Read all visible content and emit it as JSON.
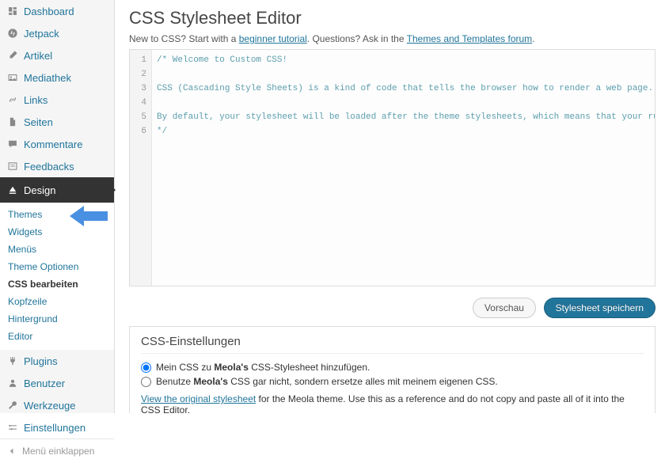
{
  "sidebar": {
    "items": [
      {
        "label": "Dashboard",
        "icon": "dashboard"
      },
      {
        "label": "Jetpack",
        "icon": "jetpack"
      },
      {
        "label": "Artikel",
        "icon": "posts"
      },
      {
        "label": "Mediathek",
        "icon": "media"
      },
      {
        "label": "Links",
        "icon": "links"
      },
      {
        "label": "Seiten",
        "icon": "pages"
      },
      {
        "label": "Kommentare",
        "icon": "comments"
      },
      {
        "label": "Feedbacks",
        "icon": "feedback"
      }
    ],
    "active": {
      "label": "Design",
      "icon": "appearance"
    },
    "submenu": [
      {
        "label": "Themes"
      },
      {
        "label": "Widgets"
      },
      {
        "label": "Menüs"
      },
      {
        "label": "Theme Optionen"
      },
      {
        "label": "CSS bearbeiten",
        "current": true
      },
      {
        "label": "Kopfzeile"
      },
      {
        "label": "Hintergrund"
      },
      {
        "label": "Editor"
      }
    ],
    "items2": [
      {
        "label": "Plugins",
        "icon": "plugins"
      },
      {
        "label": "Benutzer",
        "icon": "users"
      },
      {
        "label": "Werkzeuge",
        "icon": "tools"
      },
      {
        "label": "Einstellungen",
        "icon": "settings"
      }
    ],
    "collapse": "Menü einklappen"
  },
  "page": {
    "title": "CSS Stylesheet Editor",
    "intro_prefix": "New to CSS? Start with a ",
    "intro_link1": "beginner tutorial",
    "intro_mid": ". Questions? Ask in the ",
    "intro_link2": "Themes and Templates forum",
    "intro_suffix": "."
  },
  "editor": {
    "lines": [
      "/* Welcome to Custom CSS!",
      "",
      "CSS (Cascading Style Sheets) is a kind of code that tells the browser how to render a web page. You may delete these comments and get started with your customizations.",
      "",
      "By default, your stylesheet will be loaded after the theme stylesheets, which means that your rules can take precedence and override the theme CSS rules. Just write here what you want to change, you don't need to copy all your theme's stylesheet content.",
      "*/"
    ]
  },
  "buttons": {
    "preview": "Vorschau",
    "save": "Stylesheet speichern"
  },
  "settings": {
    "title": "CSS-Einstellungen",
    "opt1_pre": "Mein CSS zu ",
    "opt1_bold": "Meola's",
    "opt1_post": " CSS-Stylesheet hinzufügen.",
    "opt2_pre": "Benutze ",
    "opt2_bold": "Meola's",
    "opt2_post": " CSS gar nicht, sondern ersetze alles mit meinem eigenen CSS.",
    "note_link": "View the original stylesheet",
    "note_rest": " for the Meola theme. Use this as a reference and do not copy and paste all of it into the CSS Editor."
  }
}
